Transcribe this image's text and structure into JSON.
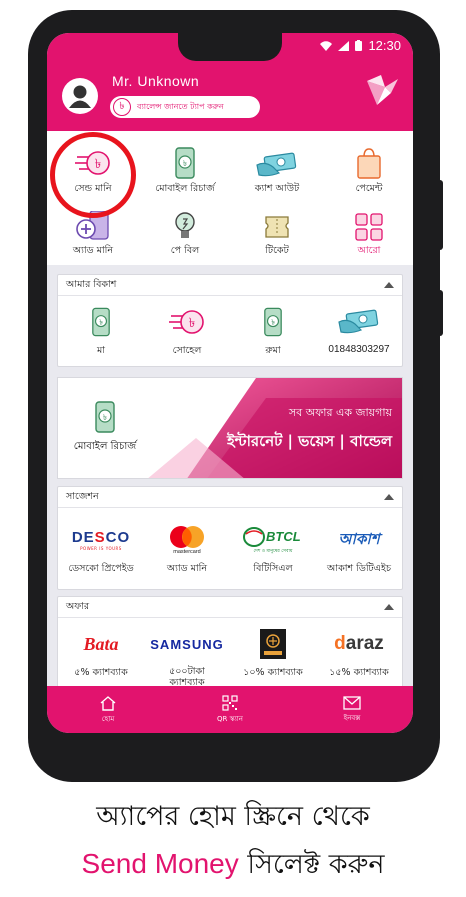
{
  "status_bar": {
    "time": "12:30"
  },
  "header": {
    "username": "Mr. Unknown",
    "balance_prompt": "ব্যালেন্স জানতে ট্যাপ করুন",
    "taka_symbol": "৳"
  },
  "actions": [
    {
      "label": "সেন্ড মানি",
      "icon": "send-money-icon"
    },
    {
      "label": "মোবাইল রিচার্জ",
      "icon": "mobile-recharge-icon"
    },
    {
      "label": "ক্যাশ আউট",
      "icon": "cash-out-icon"
    },
    {
      "label": "পেমেন্ট",
      "icon": "payment-bag-icon"
    },
    {
      "label": "অ্যাড মানি",
      "icon": "add-money-icon"
    },
    {
      "label": "পে বিল",
      "icon": "pay-bill-bulb-icon"
    },
    {
      "label": "টিকেট",
      "icon": "ticket-icon"
    },
    {
      "label": "আরো",
      "icon": "more-grid-icon"
    }
  ],
  "my_bkash": {
    "title": "আমার বিকাশ",
    "items": [
      {
        "label": "মা",
        "icon": "mobile-recharge-icon"
      },
      {
        "label": "সোহেল",
        "icon": "send-money-icon"
      },
      {
        "label": "রুমা",
        "icon": "mobile-recharge-icon"
      },
      {
        "label": "01848303297",
        "icon": "cash-out-icon"
      }
    ]
  },
  "banner": {
    "left_label": "মোবাইল রিচার্জ",
    "line1": "সব অফার এক জায়গায়",
    "line2": "ইন্টারনেট | ভয়েস | বান্ডেল"
  },
  "suggestions": {
    "title": "সাজেশন",
    "items": [
      {
        "label": "ডেসকো প্রিপেইড",
        "logo": "DESCO",
        "logo_sub": "POWER IS YOURS"
      },
      {
        "label": "অ্যাড মানি",
        "logo": "mastercard"
      },
      {
        "label": "বিটিসিএল",
        "logo": "BTCL",
        "logo_sub": "দেশ ও মানুষের সেবায়"
      },
      {
        "label": "আকাশ ডিটিএইচ",
        "logo": "আকাশ"
      }
    ]
  },
  "offers": {
    "title": "অফার",
    "items": [
      {
        "label": "৫% ক্যাশব্যাক",
        "logo": "Bata"
      },
      {
        "label": "৫০০টাকা ক্যাশব্যাক",
        "logo": "SAMSUNG"
      },
      {
        "label": "১০% ক্যাশব্যাক",
        "logo": "shop-logo"
      },
      {
        "label": "১৫% ক্যাশব্যাক",
        "logo": "daraz"
      }
    ]
  },
  "bottom_nav": [
    {
      "label": "হোম",
      "icon": "home-icon"
    },
    {
      "label": "QR স্ক্যান",
      "icon": "qr-icon"
    },
    {
      "label": "ইনবক্স",
      "icon": "inbox-icon"
    }
  ],
  "caption": {
    "line1": "অ্যাপের হোম স্ক্রিনে থেকে",
    "highlight": "Send Money",
    "line2_rest": "সিলেক্ট করুন"
  },
  "colors": {
    "brand": "#e2136e",
    "highlight_ring": "#e8141d"
  }
}
